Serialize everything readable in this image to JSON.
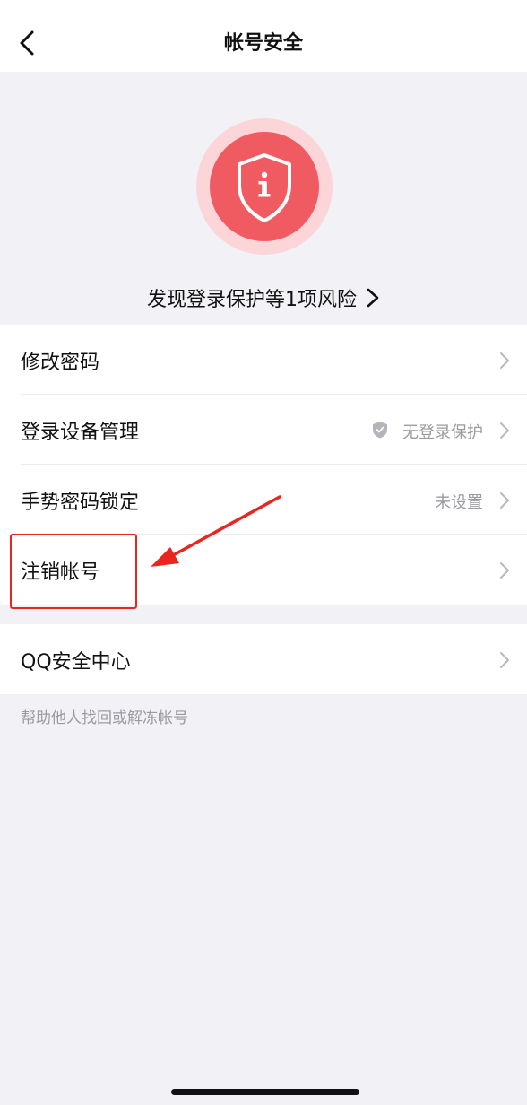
{
  "nav": {
    "title": "帐号安全",
    "back_icon": "chevron-left-icon"
  },
  "hero": {
    "shield_icon": "shield-info-icon",
    "risk_text": "发现登录保护等1项风险",
    "colors": {
      "badge": "#f05a61",
      "halo": "#fbd5d8"
    }
  },
  "settings": {
    "change_password": {
      "label": "修改密码"
    },
    "device_management": {
      "label": "登录设备管理",
      "status": "无登录保护"
    },
    "gesture_lock": {
      "label": "手势密码锁定",
      "status": "未设置"
    },
    "cancel_account": {
      "label": "注销帐号"
    },
    "qq_security_center": {
      "label": "QQ安全中心"
    }
  },
  "footnote": "帮助他人找回或解冻帐号",
  "annotation": {
    "color": "#e8251f"
  }
}
